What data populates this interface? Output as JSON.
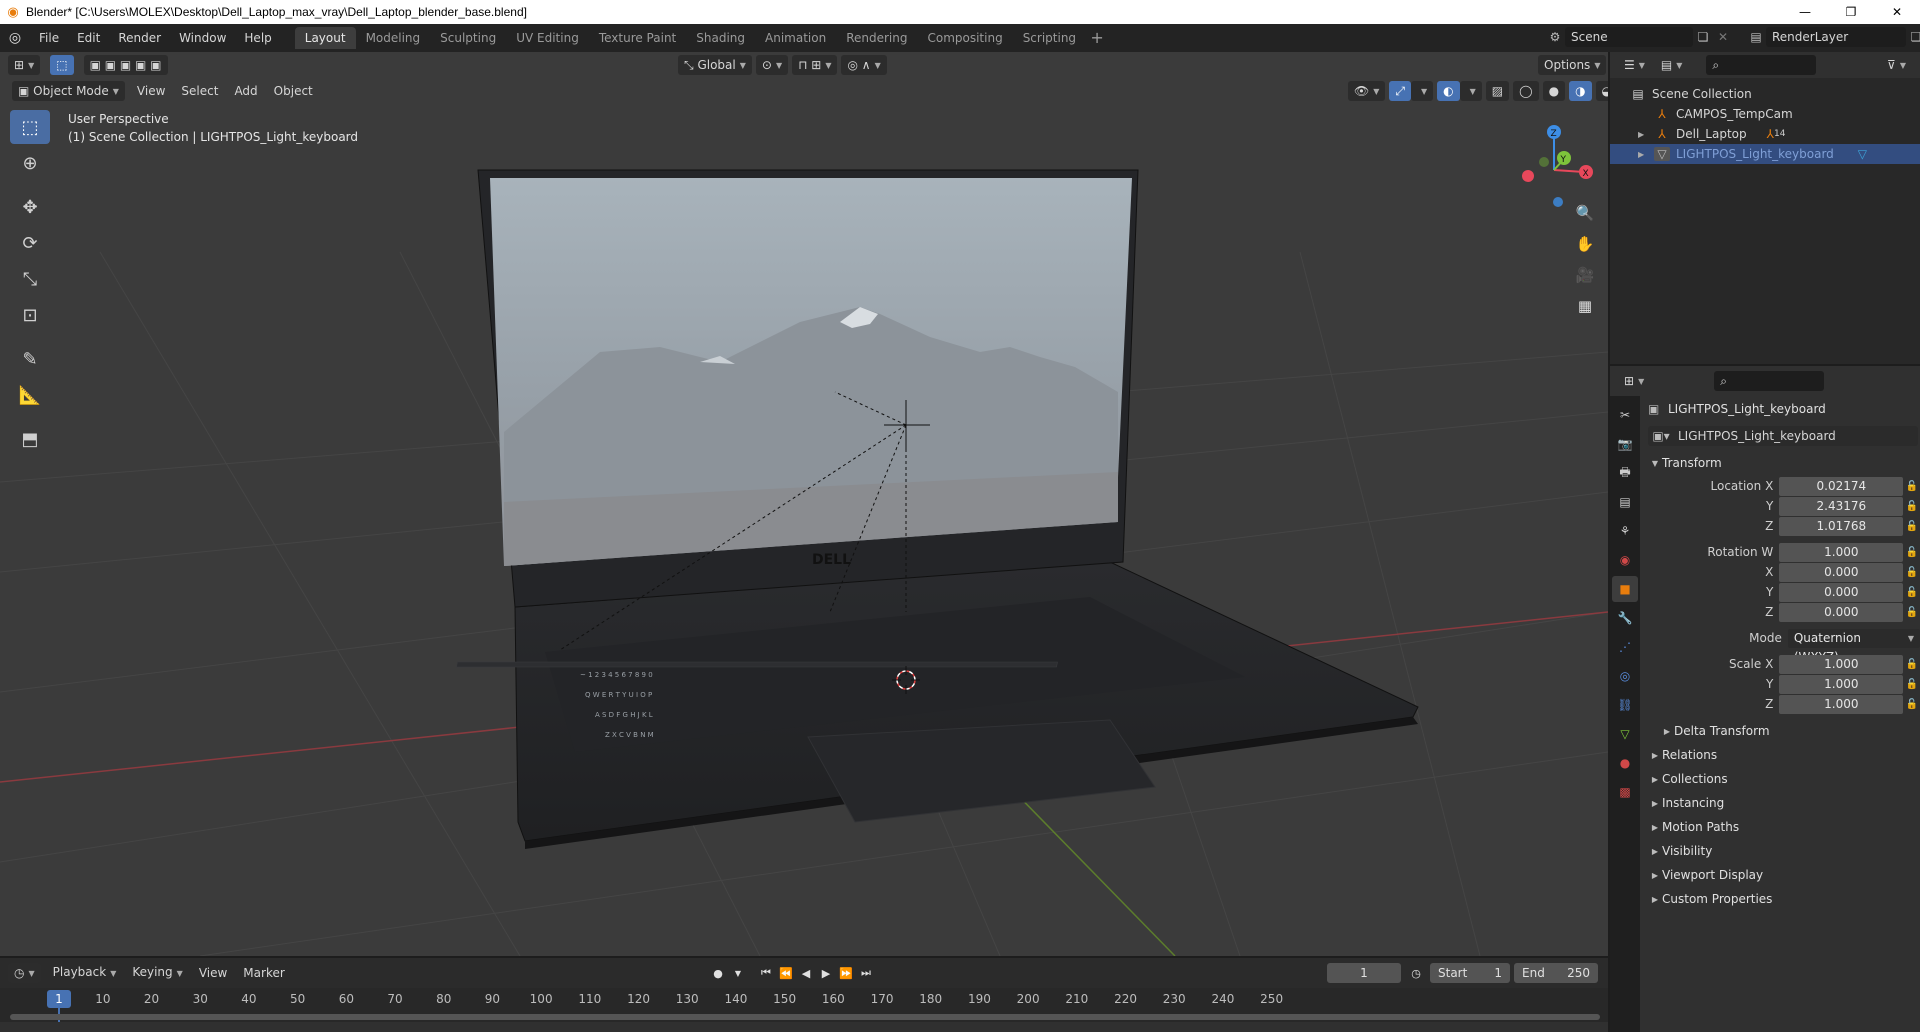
{
  "window": {
    "title": "Blender* [C:\\Users\\MOLEX\\Desktop\\Dell_Laptop_max_vray\\Dell_Laptop_blender_base.blend]"
  },
  "menu": [
    "File",
    "Edit",
    "Render",
    "Window",
    "Help"
  ],
  "workspaces": [
    "Layout",
    "Modeling",
    "Sculpting",
    "UV Editing",
    "Texture Paint",
    "Shading",
    "Animation",
    "Rendering",
    "Compositing",
    "Scripting"
  ],
  "active_workspace": "Layout",
  "scene": {
    "name": "Scene",
    "view_layer": "RenderLayer"
  },
  "viewport": {
    "transform_orientation": "Global",
    "options_label": "Options",
    "mode": "Object Mode",
    "menus": [
      "View",
      "Select",
      "Add",
      "Object"
    ],
    "info_line1": "User Perspective",
    "info_line2": "(1) Scene Collection | LIGHTPOS_Light_keyboard",
    "gizmo": {
      "x": "X",
      "y": "Y",
      "z": "Z"
    },
    "screen_brand": "DELL"
  },
  "outliner": {
    "rows": [
      {
        "label": "Scene Collection",
        "icon": "collection-icon",
        "indent": 0,
        "selected": false
      },
      {
        "label": "CAMPOS_TempCam",
        "icon": "object-icon",
        "indent": 1,
        "selected": false
      },
      {
        "label": "Dell_Laptop",
        "icon": "object-icon",
        "indent": 1,
        "selected": false,
        "badge": "14"
      },
      {
        "label": "LIGHTPOS_Light_keyboard",
        "icon": "mesh-icon",
        "indent": 1,
        "selected": true
      }
    ]
  },
  "properties": {
    "object_name": "LIGHTPOS_Light_keyboard",
    "object_name_field": "LIGHTPOS_Light_keyboard",
    "transform_label": "Transform",
    "location": {
      "label": "Location X",
      "x": "0.02174",
      "y": "2.43176",
      "z": "1.01768"
    },
    "rotation": {
      "label": "Rotation W",
      "w": "1.000",
      "x": "0.000",
      "y": "0.000",
      "z": "0.000"
    },
    "mode_label": "Mode",
    "mode_value": "Quaternion (WXYZ)",
    "scale": {
      "label": "Scale X",
      "x": "1.000",
      "y": "1.000",
      "z": "1.000"
    },
    "axis_labels": {
      "x": "X",
      "y": "Y",
      "z": "Z"
    },
    "delta_transform": "Delta Transform",
    "panels": [
      "Relations",
      "Collections",
      "Instancing",
      "Motion Paths",
      "Visibility",
      "Viewport Display",
      "Custom Properties"
    ]
  },
  "timeline": {
    "menus": [
      "Playback",
      "Keying",
      "View",
      "Marker"
    ],
    "current_frame": "1",
    "start_label": "Start",
    "start": "1",
    "end_label": "End",
    "end": "250",
    "ticks": [
      "10",
      "20",
      "30",
      "40",
      "50",
      "60",
      "70",
      "80",
      "90",
      "100",
      "110",
      "120",
      "130",
      "140",
      "150",
      "160",
      "170",
      "180",
      "190",
      "200",
      "210",
      "220",
      "230",
      "240",
      "250"
    ],
    "cursor": "1"
  },
  "colors": {
    "accent": "#4772b3",
    "axis_x": "#e8485b",
    "axis_y": "#7ec43b",
    "axis_z": "#3d8ee6",
    "object_orange": "#e87d0d"
  }
}
